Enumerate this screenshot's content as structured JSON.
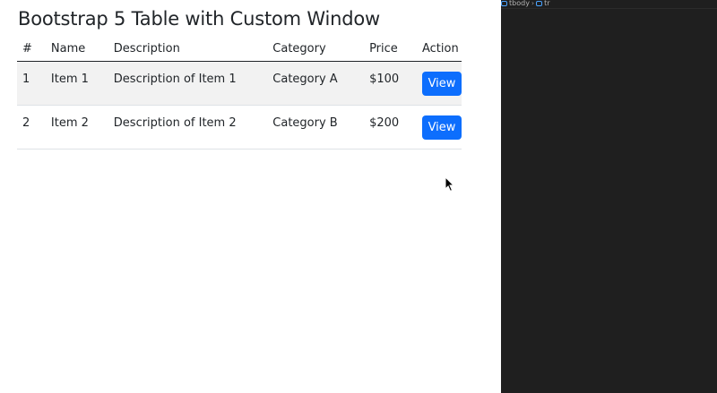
{
  "page": {
    "title": "Bootstrap 5 Table with Custom Window"
  },
  "table": {
    "headers": [
      "#",
      "Name",
      "Description",
      "Category",
      "Price",
      "Action"
    ],
    "rows": [
      {
        "num": "1",
        "name": "Item 1",
        "description": "Description of Item 1",
        "category": "Category A",
        "price": "$100",
        "action_label": "View"
      },
      {
        "num": "2",
        "name": "Item 2",
        "description": "Description of Item 2",
        "category": "Category B",
        "price": "$200",
        "action_label": "View"
      }
    ]
  },
  "editor_panel": {
    "breadcrumb": [
      "tbody",
      "tr"
    ],
    "background": "#1f1f1f"
  },
  "colors": {
    "primary_button": "#0d6efd",
    "striped_row": "#f2f2f2",
    "text": "#212529"
  }
}
